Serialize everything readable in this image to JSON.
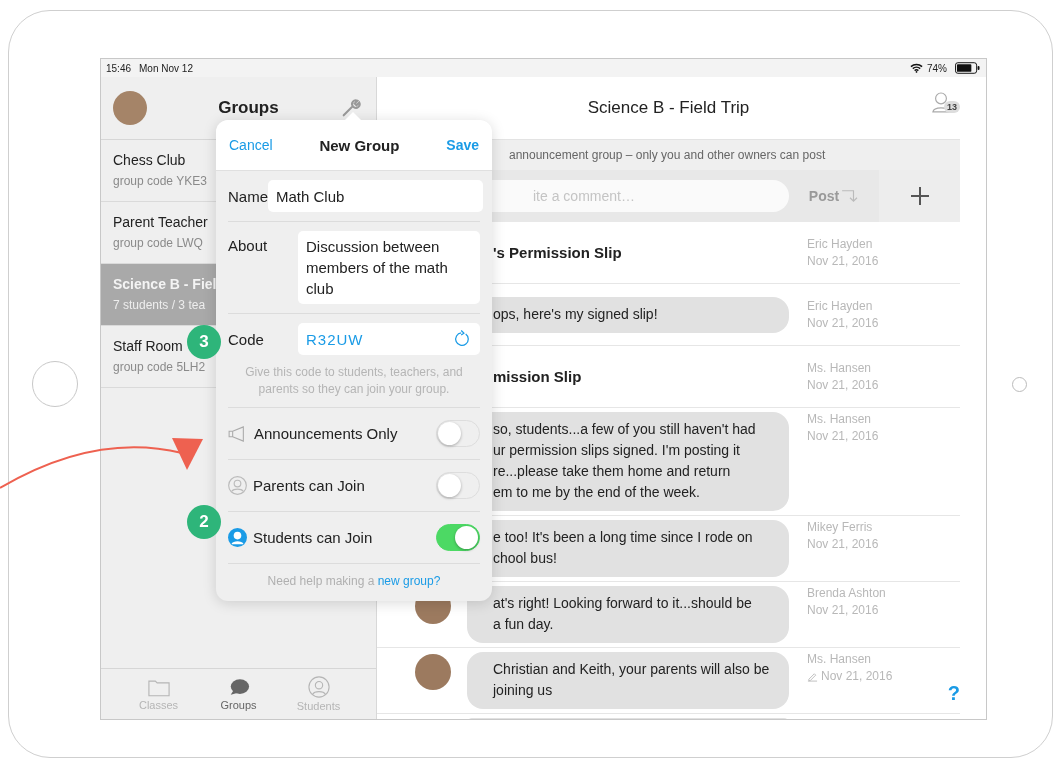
{
  "status_bar": {
    "time": "15:46",
    "date": "Mon Nov 12",
    "battery": "74%"
  },
  "sidebar": {
    "title": "Groups",
    "items": [
      {
        "name": "Chess Club",
        "detail": "group code YKE3",
        "selected": false
      },
      {
        "name": "Parent Teacher",
        "detail": "group code LWQ",
        "selected": false
      },
      {
        "name": "Science B - Fiel",
        "detail": "7 students / 3 tea",
        "selected": true
      },
      {
        "name": "Staff Room",
        "detail": "group code 5LH2",
        "selected": false
      }
    ],
    "tabs": [
      {
        "label": "Classes",
        "selected": false
      },
      {
        "label": "Groups",
        "selected": true
      },
      {
        "label": "Students",
        "selected": false
      }
    ]
  },
  "chat": {
    "title": "Science B - Field Trip",
    "member_count": "13",
    "banner": "announcement group – only you and other owners can post",
    "comment": {
      "placeholder": "ite a comment…"
    },
    "post_button": "Post",
    "messages": [
      {
        "kind": "title",
        "lines": [
          "'s Permission Slip"
        ],
        "author": "Eric Hayden",
        "date": "Nov 21, 2016",
        "edited": false
      },
      {
        "kind": "bubble",
        "lines": [
          "ops, here's my signed slip!"
        ],
        "author": "Eric Hayden",
        "date": "Nov 21, 2016",
        "edited": false
      },
      {
        "kind": "title",
        "lines": [
          "mission Slip"
        ],
        "author": "Ms. Hansen",
        "date": "Nov 21, 2016",
        "edited": false
      },
      {
        "kind": "bubble",
        "lines": [
          "so, students...a few of you still haven't had",
          "ur permission slips signed. I'm posting it",
          "re...please take them home and return",
          "em to me by the end of the week."
        ],
        "author": "Ms. Hansen",
        "date": "Nov 21, 2016",
        "edited": false
      },
      {
        "kind": "bubble",
        "lines": [
          "e too! It's been a long time since I rode on",
          "chool bus!"
        ],
        "author": "Mikey Ferris",
        "date": "Nov 21, 2016",
        "edited": false
      },
      {
        "kind": "bubble",
        "lines": [
          "at's right! Looking forward to it...should be",
          "a fun day."
        ],
        "author": "Brenda Ashton",
        "date": "Nov 21, 2016",
        "edited": false
      },
      {
        "kind": "bubble",
        "lines": [
          "Christian and Keith, your parents will also be",
          "joining us"
        ],
        "author": "Ms. Hansen",
        "date": "Nov 21, 2016",
        "edited": true
      }
    ],
    "help_button": "?"
  },
  "popover": {
    "cancel": "Cancel",
    "title": "New Group",
    "save": "Save",
    "name": {
      "label": "Name",
      "value": "Math Club"
    },
    "about": {
      "label": "About",
      "value": "Discussion between members of the math club"
    },
    "code": {
      "label": "Code",
      "value": "R32UW"
    },
    "code_hint": "Give this code to students, teachers, and parents so they can join your group.",
    "toggles": [
      {
        "label": "Announcements Only",
        "on": false
      },
      {
        "label": "Parents can Join",
        "on": false
      },
      {
        "label": "Students can Join",
        "on": true
      }
    ],
    "help": {
      "text": "Need help making a",
      "link": "new group?"
    }
  },
  "annotations": [
    {
      "label": "3"
    },
    {
      "label": "2"
    }
  ]
}
